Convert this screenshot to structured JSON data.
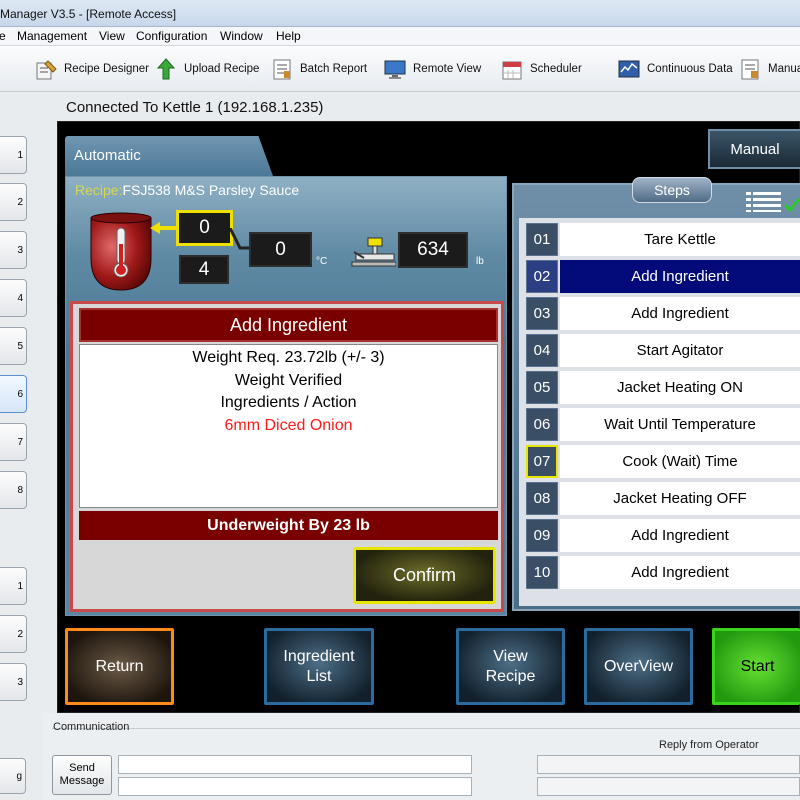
{
  "window": {
    "title": "Manager V3.5 - [Remote Access]"
  },
  "menu": [
    "e",
    "Management",
    "View",
    "Configuration",
    "Window",
    "Help"
  ],
  "toolbar": {
    "recipe_designer": "Recipe Designer",
    "upload_recipe": "Upload Recipe",
    "batch_report": "Batch Report",
    "remote_view": "Remote View",
    "scheduler": "Scheduler",
    "continuous_data": "Continuous Data",
    "manual": "Manual"
  },
  "connection": {
    "status": "Connected To Kettle 1 (192.168.1.235)"
  },
  "left_buttons": [
    "1",
    "2",
    "3",
    "4",
    "5",
    "6",
    "7",
    "8",
    "1",
    "2",
    "3",
    "g"
  ],
  "tabs": {
    "automatic": "Automatic",
    "manual": "Manual"
  },
  "recipe": {
    "label": "Recipe:",
    "name": "FSJ538 M&S Parsley Sauce"
  },
  "readouts": {
    "top": "0",
    "bottom": "4",
    "temperature": "0",
    "temperature_unit": "°C",
    "weight": "634",
    "weight_unit": "lb"
  },
  "instruction": {
    "title": "Add Ingredient",
    "line1": "Weight Req. 23.72lb (+/- 3)",
    "line2": "Weight Verified",
    "line3": "Ingredients / Action",
    "ingredient": "6mm Diced Onion",
    "status": "Underweight By 23 lb",
    "confirm": "Confirm"
  },
  "steps": {
    "title": "Steps",
    "items": [
      {
        "num": "01",
        "label": "Tare Kettle"
      },
      {
        "num": "02",
        "label": "Add Ingredient"
      },
      {
        "num": "03",
        "label": "Add Ingredient"
      },
      {
        "num": "04",
        "label": "Start Agitator"
      },
      {
        "num": "05",
        "label": "Jacket Heating ON"
      },
      {
        "num": "06",
        "label": "Wait Until Temperature"
      },
      {
        "num": "07",
        "label": "Cook (Wait) Time"
      },
      {
        "num": "08",
        "label": "Jacket Heating OFF"
      },
      {
        "num": "09",
        "label": "Add Ingredient"
      },
      {
        "num": "10",
        "label": "Add Ingredient"
      }
    ],
    "active_index": 1
  },
  "actions": {
    "return": "Return",
    "ingredient_list_1": "Ingredient",
    "ingredient_list_2": "List",
    "view_recipe_1": "View",
    "view_recipe_2": "Recipe",
    "overview": "OverView",
    "start": "Start"
  },
  "communication": {
    "label": "Communication",
    "send_1": "Send",
    "send_2": "Message",
    "reply_label": "Reply from Operator"
  },
  "colors": {
    "active_step": "#030b7a",
    "warning_red": "#7a0000",
    "confirm_border": "#e6e600",
    "return_border": "#ff8a1a",
    "start_green": "#3ad41a"
  }
}
